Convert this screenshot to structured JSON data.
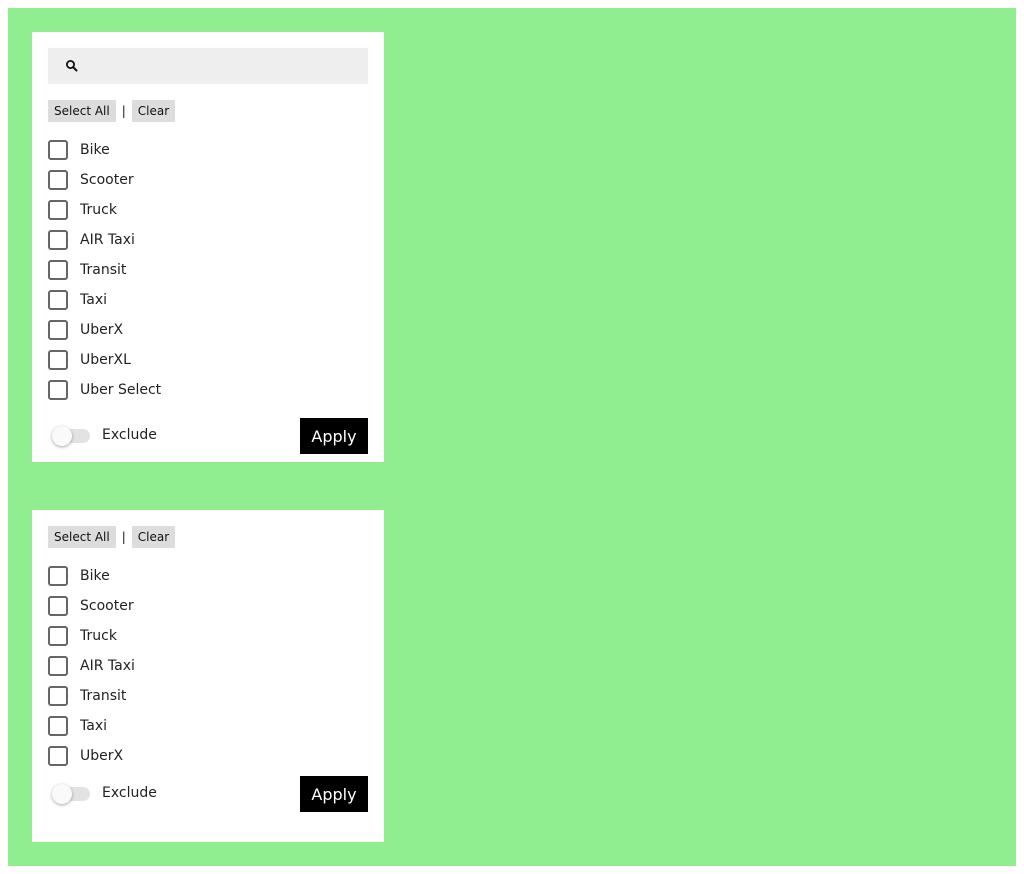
{
  "colors": {
    "background": "#90ee90",
    "panel": "#ffffff",
    "apply_button": "#000000",
    "search_field": "#eeeeee"
  },
  "panel1": {
    "search": {
      "value": "",
      "placeholder": "",
      "icon": "search-icon"
    },
    "select_all_label": "Select All",
    "separator": "|",
    "clear_label": "Clear",
    "items": [
      {
        "label": "Bike",
        "checked": false
      },
      {
        "label": "Scooter",
        "checked": false
      },
      {
        "label": "Truck",
        "checked": false
      },
      {
        "label": "AIR Taxi",
        "checked": false
      },
      {
        "label": "Transit",
        "checked": false
      },
      {
        "label": "Taxi",
        "checked": false
      },
      {
        "label": "UberX",
        "checked": false
      },
      {
        "label": "UberXL",
        "checked": false
      },
      {
        "label": "Uber Select",
        "checked": false
      }
    ],
    "exclude_toggle": {
      "label": "Exclude",
      "on": false
    },
    "apply_label": "Apply"
  },
  "panel2": {
    "select_all_label": "Select All",
    "separator": "|",
    "clear_label": "Clear",
    "items": [
      {
        "label": "Bike",
        "checked": false
      },
      {
        "label": "Scooter",
        "checked": false
      },
      {
        "label": "Truck",
        "checked": false
      },
      {
        "label": "AIR Taxi",
        "checked": false
      },
      {
        "label": "Transit",
        "checked": false
      },
      {
        "label": "Taxi",
        "checked": false
      },
      {
        "label": "UberX",
        "checked": false
      }
    ],
    "exclude_toggle": {
      "label": "Exclude",
      "on": false
    },
    "apply_label": "Apply"
  }
}
